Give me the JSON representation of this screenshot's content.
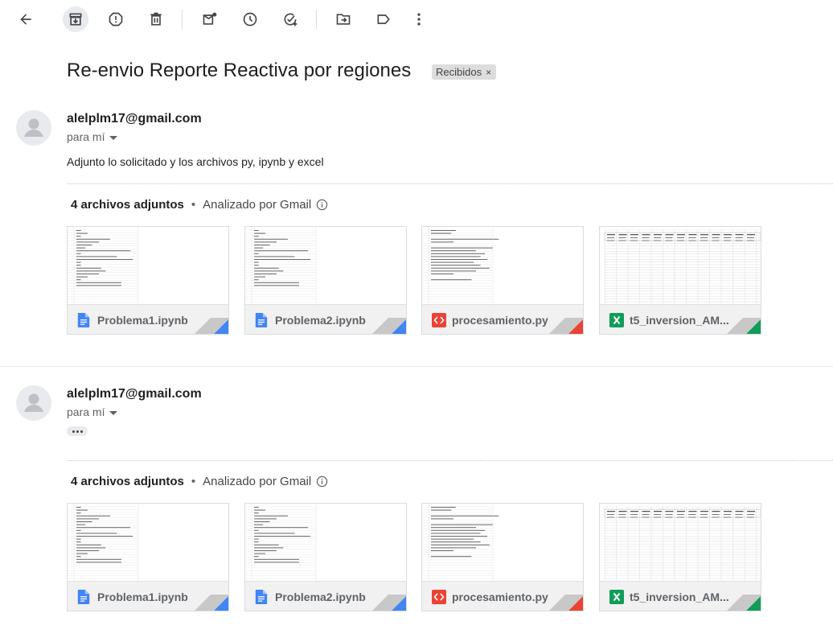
{
  "toolbar": {
    "back": "arrow-left-icon",
    "archive": "archive-icon",
    "spam": "report-spam-icon",
    "delete": "trash-icon",
    "unread": "mark-unread-icon",
    "snooze": "snooze-clock-icon",
    "task": "add-task-icon",
    "move": "move-to-folder-icon",
    "label": "label-icon",
    "more": "more-vert-icon"
  },
  "subject": "Re-envio Reporte Reactiva por regiones",
  "label_chip": {
    "text": "Recibidos",
    "close": "×"
  },
  "messages": [
    {
      "sender": "alelplm17@gmail.com",
      "to": "para mí",
      "body": "Adjunto lo solicitado y los archivos py, ipynb y excel",
      "attachments_count": "4 archivos adjuntos",
      "separator": "•",
      "analyzed": "Analizado por Gmail",
      "files": [
        {
          "name": "Problema1.ipynb",
          "icon": "google-docs-icon",
          "color": "#4285f4"
        },
        {
          "name": "Problema2.ipynb",
          "icon": "google-docs-icon",
          "color": "#4285f4"
        },
        {
          "name": "procesamiento.py",
          "icon": "code-file-icon",
          "color": "#ea4335"
        },
        {
          "name": "t5_inversion_AM...",
          "icon": "excel-icon",
          "color": "#0f9d58"
        }
      ]
    },
    {
      "sender": "alelplm17@gmail.com",
      "to": "para mí",
      "attachments_count": "4 archivos adjuntos",
      "separator": "•",
      "analyzed": "Analizado por Gmail",
      "files": [
        {
          "name": "Problema1.ipynb",
          "icon": "google-docs-icon",
          "color": "#4285f4"
        },
        {
          "name": "Problema2.ipynb",
          "icon": "google-docs-icon",
          "color": "#4285f4"
        },
        {
          "name": "procesamiento.py",
          "icon": "code-file-icon",
          "color": "#ea4335"
        },
        {
          "name": "t5_inversion_AM...",
          "icon": "excel-icon",
          "color": "#0f9d58"
        }
      ]
    }
  ]
}
